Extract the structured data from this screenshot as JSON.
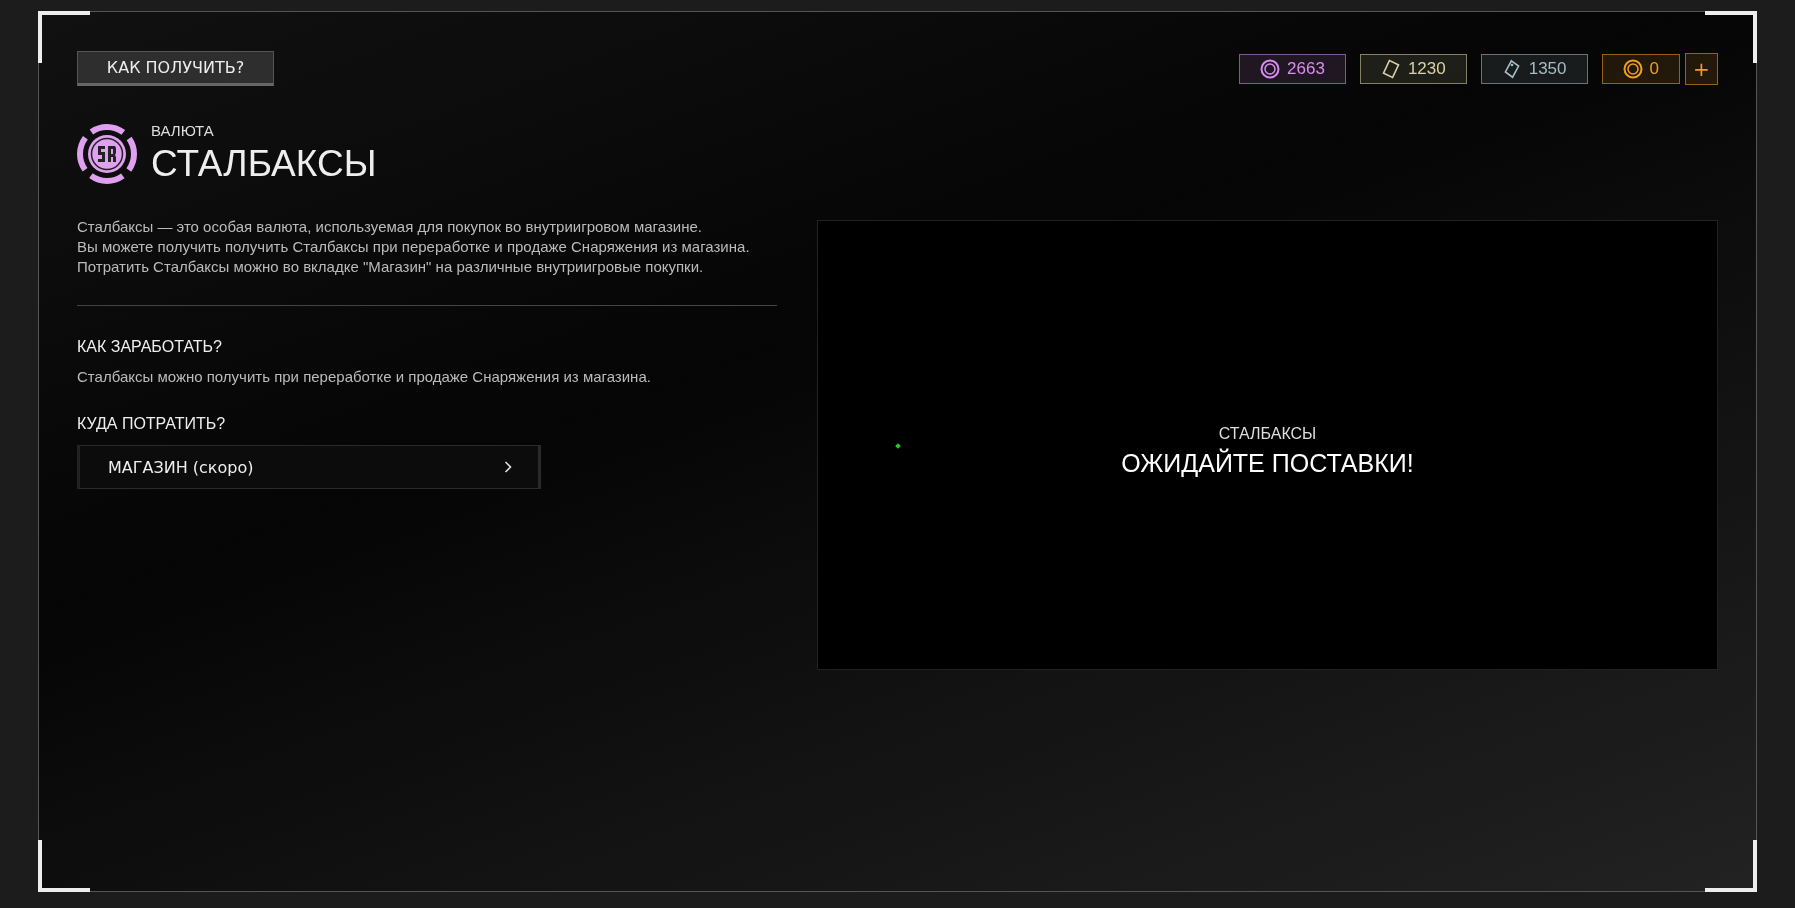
{
  "how_to_get_button": "КАК ПОЛУЧИТЬ?",
  "currencies": [
    {
      "kind": "coin",
      "amount": "2663",
      "color": "#d88ef0"
    },
    {
      "kind": "ticket",
      "amount": "1230",
      "color": "#d8d2a8"
    },
    {
      "kind": "tag",
      "amount": "1350",
      "color": "#a8bcc4"
    },
    {
      "kind": "coin",
      "amount": "0",
      "color": "#f0a020"
    }
  ],
  "add_button": "+",
  "header": {
    "subtitle": "ВАЛЮТА",
    "title": "СТАЛБАКСЫ"
  },
  "description": [
    "Сталбаксы — это особая валюта, используемая для покупок во внутриигровом магазине.",
    "Вы можете получить получить Сталбаксы при переработке и продаже Снаряжения из магазина.",
    "Потратить Сталбаксы можно во вкладке \"Магазин\" на различные внутриигровые покупки."
  ],
  "earn": {
    "heading": "КАК ЗАРАБОТАТЬ?",
    "text": "Сталбаксы можно получить при переработке и продаже Снаряжения из магазина."
  },
  "spend": {
    "heading": "КУДА ПОТРАТИТЬ?",
    "items": [
      {
        "label": "МАГАЗИН (скоро)"
      }
    ]
  },
  "preview": {
    "caption": "СТАЛБАКСЫ",
    "message": "ОЖИДАЙТЕ ПОСТАВКИ!"
  }
}
